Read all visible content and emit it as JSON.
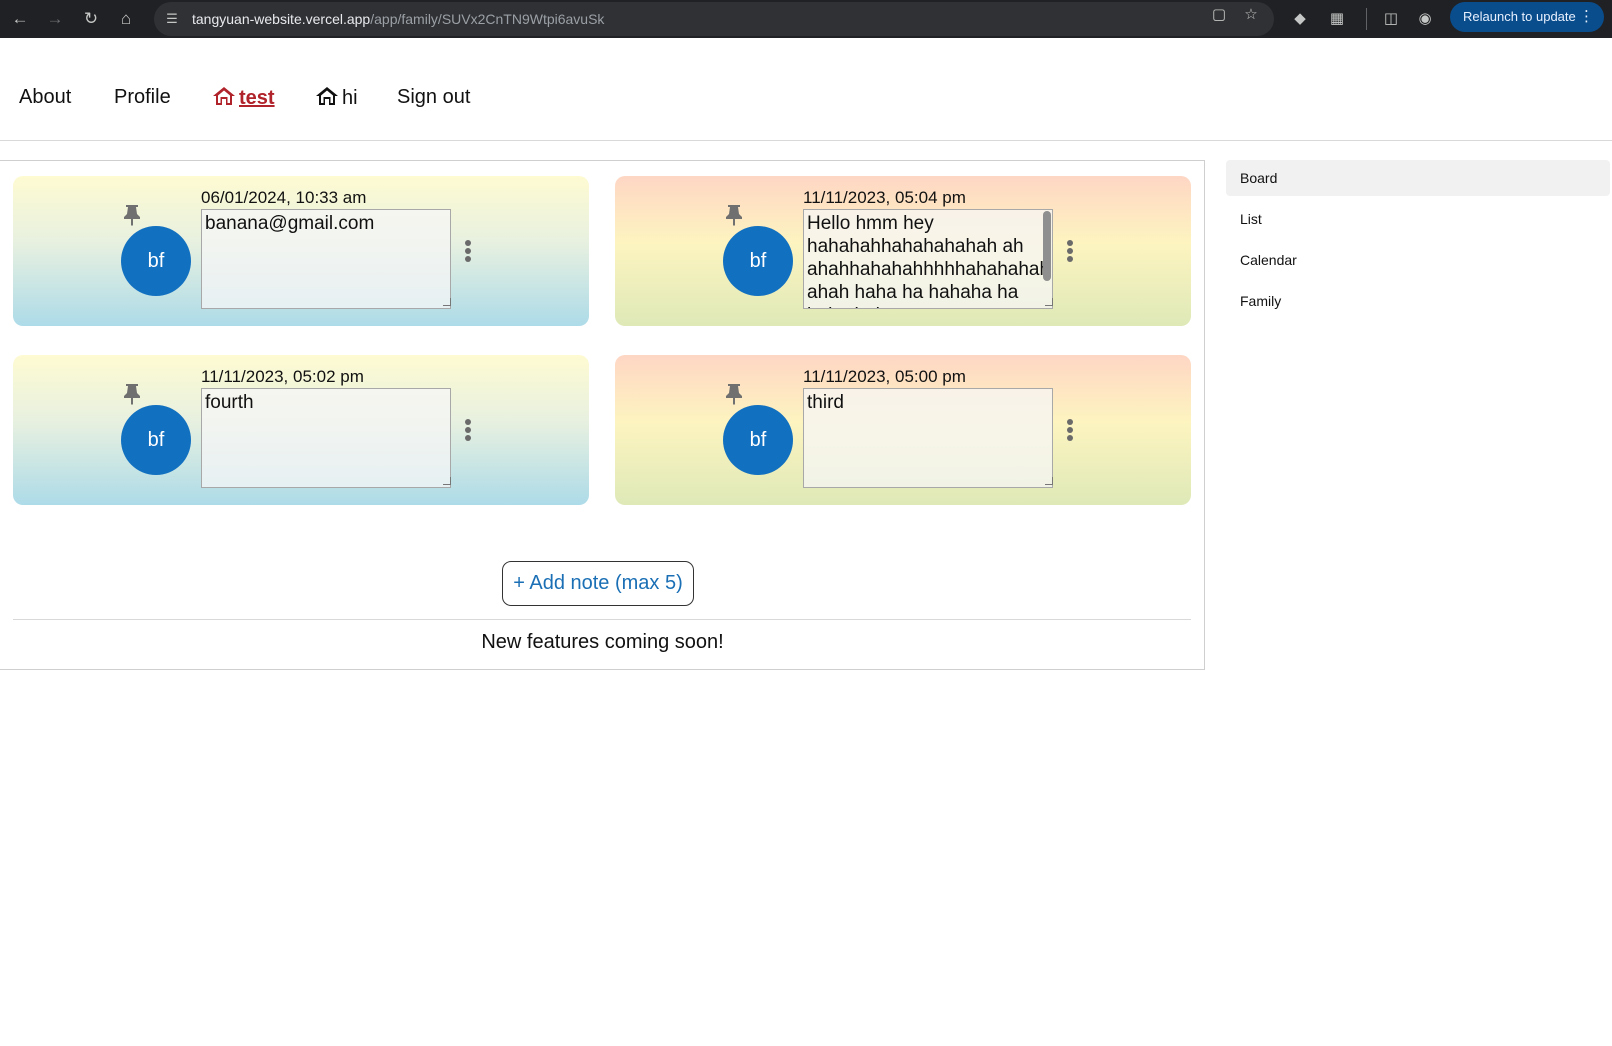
{
  "browser": {
    "url_host": "tangyuan-website.vercel.app",
    "url_path": "/app/family/SUVx2CnTN9Wtpi6avuSk",
    "relaunch_label": "Relaunch to update"
  },
  "nav": {
    "about": "About",
    "profile": "Profile",
    "family_test": "test",
    "family_hi": "hi",
    "sign_out": "Sign out"
  },
  "notes": [
    {
      "timestamp": "06/01/2024, 10:33 am",
      "text": "banana@gmail.com",
      "avatar": "bf"
    },
    {
      "timestamp": "11/11/2023, 05:04 pm",
      "text": "Hello hmm hey hahahahhahahahahah ah ahahhahahahhhhhahahahah ahah haha ha hahaha ha haha haha",
      "avatar": "bf"
    },
    {
      "timestamp": "11/11/2023, 05:02 pm",
      "text": "fourth",
      "avatar": "bf"
    },
    {
      "timestamp": "11/11/2023, 05:00 pm",
      "text": "third",
      "avatar": "bf"
    }
  ],
  "board": {
    "add_label": "+ Add note (max 5)",
    "footer": "New features coming soon!"
  },
  "sidebar": {
    "items": [
      {
        "label": "Board"
      },
      {
        "label": "List"
      },
      {
        "label": "Calendar"
      },
      {
        "label": "Family"
      }
    ]
  },
  "colors": {
    "active_link": "#b0232a",
    "avatar": "#1270c0",
    "add_button_text": "#1a6fb5"
  }
}
